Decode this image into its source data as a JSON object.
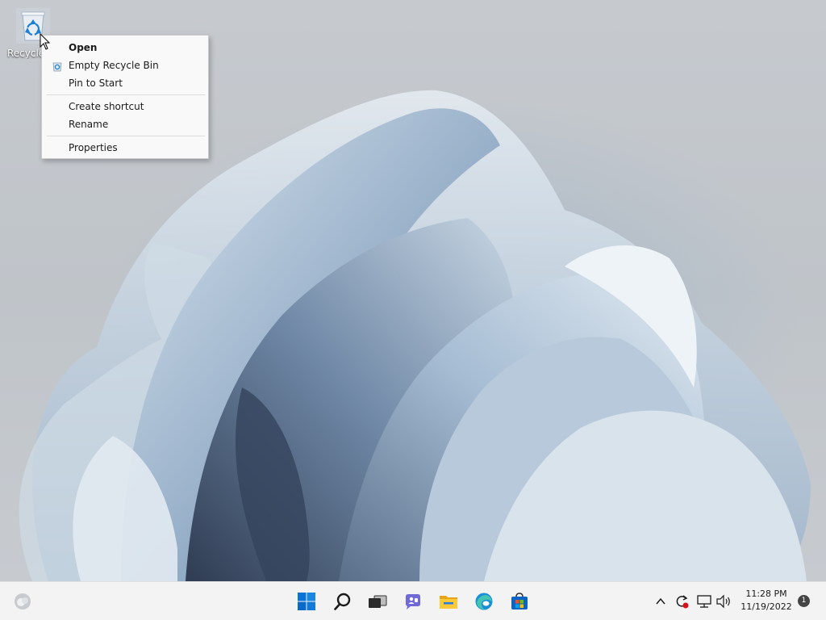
{
  "desktop": {
    "recycle_bin_label": "Recycle"
  },
  "context_menu": {
    "items": [
      {
        "label": "Open",
        "bold": true
      },
      {
        "label": "Empty Recycle Bin",
        "icon": "recycle-bin-icon"
      },
      {
        "label": "Pin to Start"
      },
      {
        "label": "Create shortcut"
      },
      {
        "label": "Rename"
      },
      {
        "label": "Properties"
      }
    ]
  },
  "taskbar": {
    "icons": [
      "weather-icon",
      "start-icon",
      "search-icon",
      "task-view-icon",
      "chat-icon",
      "file-explorer-icon",
      "edge-icon",
      "store-icon"
    ],
    "tray": {
      "icons": [
        "chevron-up-icon",
        "update-icon",
        "network-icon",
        "volume-icon"
      ],
      "time": "11:28 PM",
      "date": "11/19/2022",
      "notification_count": "1"
    }
  },
  "colors": {
    "accent": "#0067c0",
    "taskbar_bg": "#f3f3f3",
    "menu_bg": "#f9f9f9"
  }
}
